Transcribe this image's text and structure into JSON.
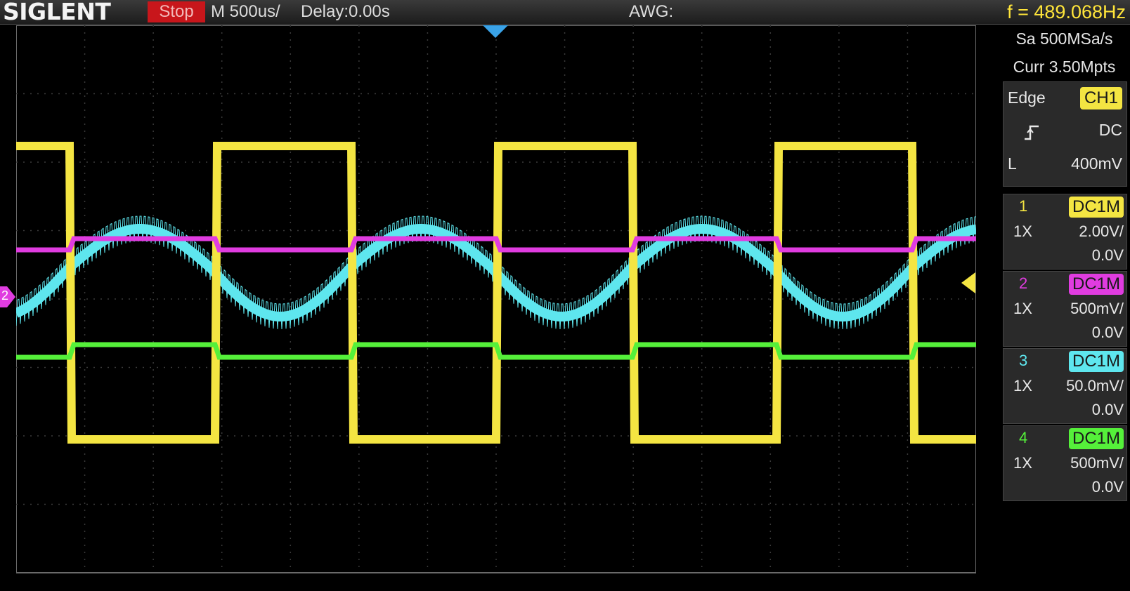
{
  "topbar": {
    "brand": "SIGLENT",
    "run_state": "Stop",
    "timebase": "M 500us/",
    "delay": "Delay:0.00s",
    "awg": "AWG:",
    "frequency": "f = 489.068Hz"
  },
  "acquisition": {
    "sample_rate": "Sa 500MSa/s",
    "memory_depth": "Curr 3.50Mpts"
  },
  "trigger": {
    "type": "Edge",
    "source": "CH1",
    "slope_icon": "rising-edge-icon",
    "coupling": "DC",
    "level_label": "L",
    "level": "400mV"
  },
  "channels": [
    {
      "number": "1",
      "coupling": "DC1M",
      "probe": "1X",
      "scale": "2.00V/",
      "offset": "0.0V",
      "color": "#f4e542"
    },
    {
      "number": "2",
      "coupling": "DC1M",
      "probe": "1X",
      "scale": "500mV/",
      "offset": "0.0V",
      "color": "#e03ce0"
    },
    {
      "number": "3",
      "coupling": "DC1M",
      "probe": "1X",
      "scale": "50.0mV/",
      "offset": "0.0V",
      "color": "#5ee6ee"
    },
    {
      "number": "4",
      "coupling": "DC1M",
      "probe": "1X",
      "scale": "500mV/",
      "offset": "0.0V",
      "color": "#55f03a"
    }
  ],
  "markers": {
    "ch2_ground": "2"
  }
}
